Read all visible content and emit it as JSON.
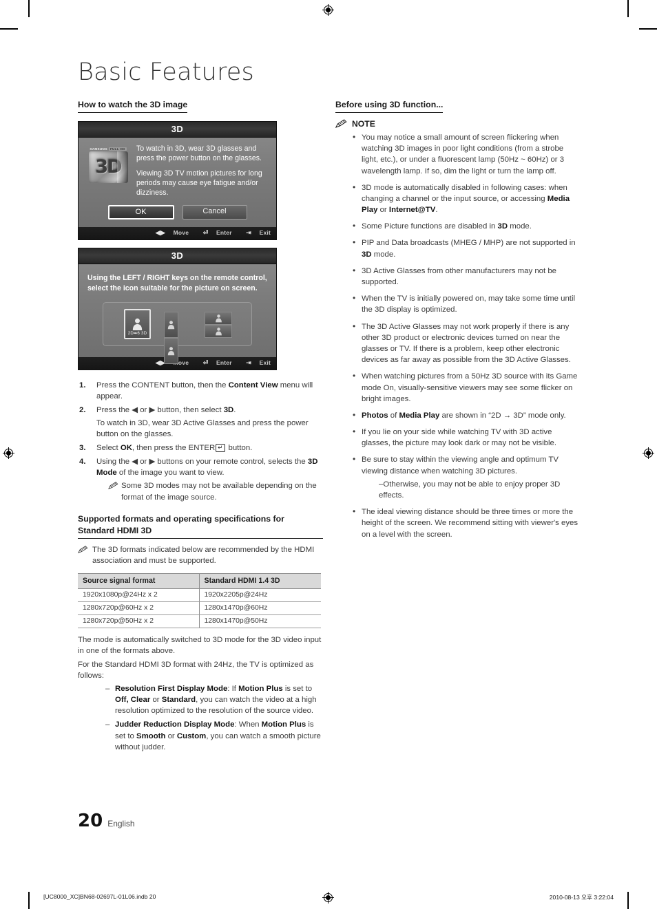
{
  "document": {
    "title": "Basic Features",
    "page_number": "20",
    "language": "English",
    "footer_left": "[UC8000_XC]BN68-02697L-01L06.indb   20",
    "footer_right": "2010-08-13   오후 3:22:04"
  },
  "left_column": {
    "heading": "How to watch the 3D image",
    "screen_one": {
      "title": "3D",
      "paragraph_1": "To watch in 3D, wear 3D glasses and press the power button on the glasses.",
      "paragraph_2": "Viewing 3D TV motion pictures for long periods may cause eye fatigue and/or dizziness.",
      "logo_brand": "SAMSUNG",
      "logo_badge": "FULL HD",
      "logo_text": "3D",
      "button_ok": "OK",
      "button_cancel": "Cancel",
      "nav_move": "Move",
      "nav_enter": "Enter",
      "nav_exit": "Exit"
    },
    "screen_two": {
      "title": "3D",
      "instruction": "Using the LEFT / RIGHT keys on the remote control, select the icon suitable for the picture on screen.",
      "mode_label_1": "2D➡6 3D",
      "nav_move": "Move",
      "nav_enter": "Enter",
      "nav_exit": "Exit"
    },
    "steps": [
      "Press the CONTENT button, then the <b>Content View</b> menu will appear.",
      "Press the ◀ or ▶ button, then select <b>3D</b>.",
      "Select <b>OK</b>, then press the ENTER<span class=\"enter-key\">↵</span> button.",
      "Using the ◀ or ▶ buttons on your remote control, selects the <b>3D Mode</b> of the image you want to view."
    ],
    "step2_subtext": "To watch in 3D, wear 3D Active Glasses and press the power button on the glasses.",
    "step4_note": "Some 3D modes may not be available depending on the format of the image source.",
    "formats_heading": "Supported formats and operating specifications for Standard HDMI 3D",
    "formats_note": "The 3D formats indicated below are recommended by the HDMI association and must be supported.",
    "table": {
      "headers": [
        "Source signal format",
        "Standard HDMI 1.4 3D"
      ],
      "rows": [
        [
          "1920x1080p@24Hz x 2",
          "1920x2205p@24Hz"
        ],
        [
          "1280x720p@60Hz x 2",
          "1280x1470p@60Hz"
        ],
        [
          "1280x720p@50Hz x 2",
          "1280x1470p@50Hz"
        ]
      ]
    },
    "para_after_table_1": "The mode is automatically switched to 3D mode for the 3D video input in one of the formats above.",
    "para_after_table_2": "For the Standard HDMI 3D format with 24Hz, the TV is optimized as follows:",
    "dash_items": [
      "<b>Resolution First Display Mode</b>: If <b>Motion Plus</b> is set to <b>Off, Clear</b> or <b>Standard</b>, you can watch the video at a high resolution optimized to the resolution of the source video.",
      "<b>Judder Reduction Display Mode</b>: When <b>Motion Plus</b> is set to <b>Smooth</b> or <b>Custom</b>, you can watch a smooth picture without judder."
    ]
  },
  "right_column": {
    "heading": "Before using 3D function...",
    "note_label": "NOTE",
    "bullets": [
      "You may notice a small amount of screen flickering when watching 3D images in poor light conditions (from a strobe light, etc.), or under a fluorescent lamp (50Hz ~ 60Hz) or 3 wavelength lamp. If so, dim the light or turn the lamp off.",
      "3D mode is automatically disabled in following cases: when changing a channel or the input source, or accessing <b>Media Play</b> or <b>Internet@TV</b>.",
      "Some Picture functions are disabled in <b>3D</b> mode.",
      "PIP and Data broadcasts (MHEG / MHP) are not supported in <b>3D</b> mode.",
      "3D Active Glasses from other manufacturers may not be supported.",
      "When the TV is initially powered on, may take some time until the 3D display is optimized.",
      "The 3D Active Glasses may not work properly if there is any other 3D product or electronic devices turned on near the glasses or TV. If there is a problem, keep other electronic devices as far away as possible from the 3D Active Glasses.",
      "When watching pictures from a 50Hz 3D source with its Game mode On, visually-sensitive viewers may see some flicker on bright images.",
      "<b>Photos</b> of <b>Media Play</b> are shown in “2D → 3D” mode only.",
      "If you lie on your side while watching TV with 3D active glasses, the picture may look dark or may not be visible.",
      "Be sure to stay within the viewing angle and optimum TV viewing distance when watching 3D pictures.",
      "The ideal viewing distance should be three times or more the height of the screen. We recommend sitting with viewer's eyes on a level with the screen."
    ],
    "sub_dash_after_11": "Otherwise, you may not be able to enjoy proper 3D effects."
  },
  "colors": {
    "ink": "#2b2b2b",
    "heading_rule": "#222222",
    "table_header_bg": "#d9d9d9",
    "screen_bg": "#7d7d7d"
  }
}
